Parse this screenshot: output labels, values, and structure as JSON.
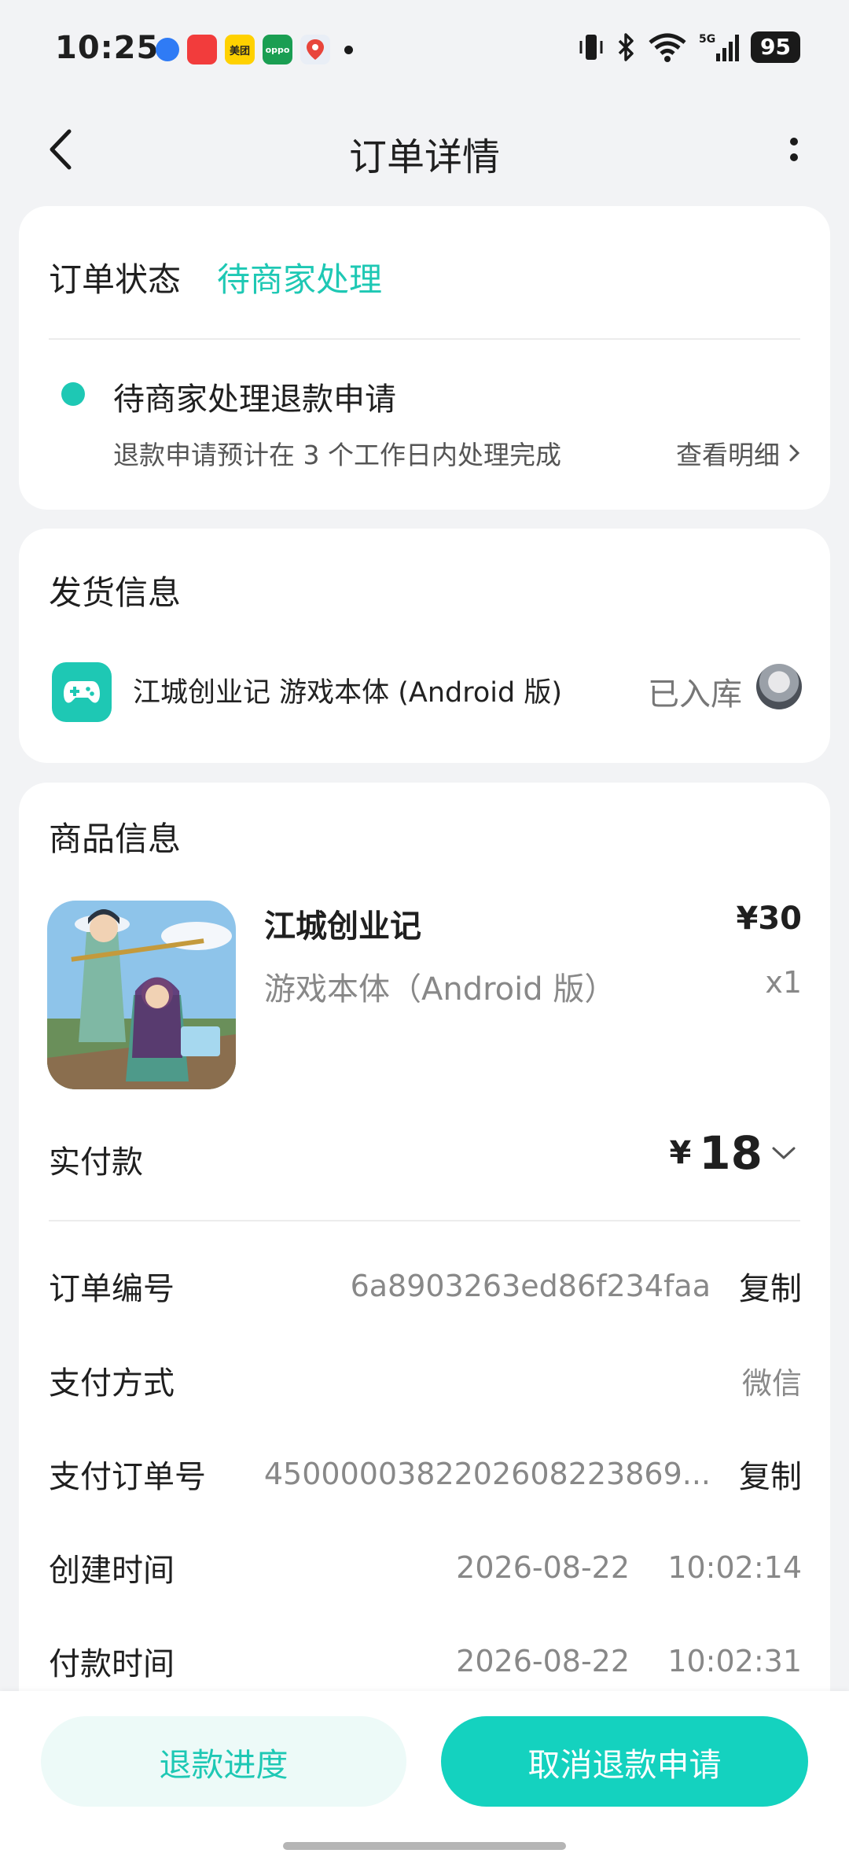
{
  "status_bar": {
    "time": "10:25",
    "app_labels": [
      "美团",
      "oppo"
    ],
    "battery": "95",
    "network": "5G"
  },
  "nav": {
    "title": "订单详情"
  },
  "order_status": {
    "label": "订单状态",
    "value": "待商家处理",
    "event_title": "待商家处理退款申请",
    "event_desc": "退款申请预计在 3 个工作日内处理完成",
    "detail_link": "查看明细"
  },
  "shipping": {
    "title": "发货信息",
    "item_name": "江城创业记 游戏本体 (Android 版)",
    "item_status": "已入库"
  },
  "product": {
    "title": "商品信息",
    "name": "江城创业记",
    "price": "¥30",
    "sku": "游戏本体（Android 版）",
    "quantity": "x1"
  },
  "payment": {
    "label": "实付款",
    "currency": "¥",
    "amount": "18"
  },
  "details": [
    {
      "label": "订单编号",
      "value": "6a8903263ed86f234faa",
      "action": "复制"
    },
    {
      "label": "支付方式",
      "value": "微信",
      "action": ""
    },
    {
      "label": "支付订单号",
      "value": "4500000382202608223869...",
      "action": "复制"
    },
    {
      "label": "创建时间",
      "value": "2026-08-22    10:02:14",
      "action": ""
    },
    {
      "label": "付款时间",
      "value": "2026-08-22    10:02:31",
      "action": ""
    }
  ],
  "bottom": {
    "secondary_label": "退款进度",
    "primary_label": "取消退款申请"
  },
  "colors": {
    "accent": "#1ec8b4",
    "primary_button": "#14d2bf",
    "secondary_button_bg": "#edfaf8",
    "page_bg": "#f2f3f5"
  },
  "icons": [
    "back-icon",
    "more-icon",
    "gamepad-icon",
    "chevron-right-icon",
    "chevron-down-icon"
  ]
}
